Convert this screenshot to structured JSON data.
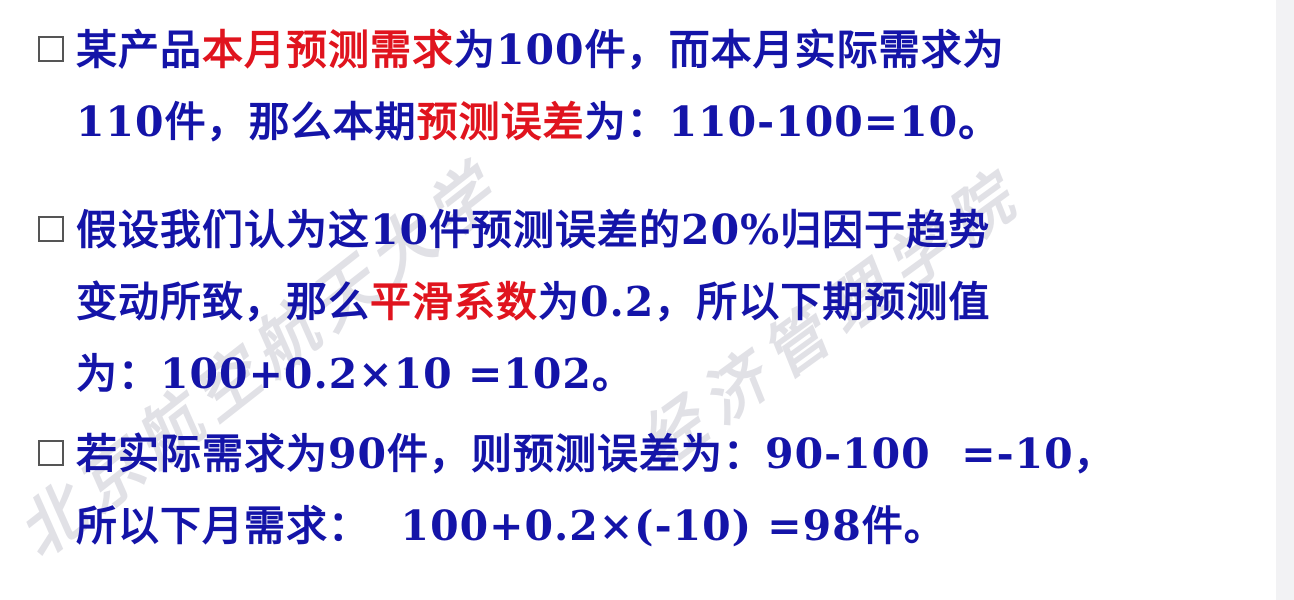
{
  "bullets": [
    {
      "lines": [
        {
          "segments": [
            {
              "text": "某产品",
              "emphasis": false
            },
            {
              "text": "本月预测需求",
              "emphasis": true
            },
            {
              "text": "为100件，而本月实际需求为",
              "emphasis": false
            }
          ]
        },
        {
          "segments": [
            {
              "text": "110件，那么本期",
              "emphasis": false
            },
            {
              "text": "预测误差",
              "emphasis": true
            },
            {
              "text": "为：110-100=10。",
              "emphasis": false
            }
          ]
        }
      ]
    },
    {
      "lines": [
        {
          "segments": [
            {
              "text": "假设我们认为这10件预测误差的20%归因于趋势",
              "emphasis": false
            }
          ]
        },
        {
          "segments": [
            {
              "text": "变动所致，那么",
              "emphasis": false
            },
            {
              "text": "平滑系数",
              "emphasis": true
            },
            {
              "text": "为0.2，所以下期预测值",
              "emphasis": false
            }
          ]
        },
        {
          "segments": [
            {
              "text": "为：100+0.2×10 =102。",
              "emphasis": false
            }
          ]
        }
      ]
    },
    {
      "lines": [
        {
          "segments": [
            {
              "text": "若实际需求为90件，则预测误差为：90-100  =-10，",
              "emphasis": false
            }
          ]
        },
        {
          "segments": [
            {
              "text": "所以下月需求：  100+0.2×(-10) =98件。",
              "emphasis": false
            }
          ]
        }
      ]
    }
  ],
  "watermark": {
    "text_1": "北京航空航天大学",
    "text_2": "经济管理学院"
  },
  "colors": {
    "body_text": "#1414a8",
    "emphasis_text": "#e0141e",
    "bullet_border": "#555555",
    "watermark": "#c9c9d2"
  },
  "icons": {
    "bullet": "hollow-square-bullet-icon"
  }
}
